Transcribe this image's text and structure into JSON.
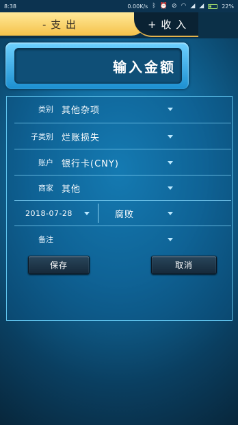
{
  "status_bar": {
    "time": "8:38",
    "net_speed": "0.00K/s",
    "battery": "22%",
    "icons": [
      "bluetooth-icon",
      "alarm-icon",
      "mute-icon",
      "wifi-icon",
      "signal-icon",
      "signal-icon",
      "battery-icon"
    ]
  },
  "tabs": {
    "expense": "- 支 出",
    "income": "+ 收 入"
  },
  "amount": {
    "placeholder": "输入金额"
  },
  "form": {
    "category": {
      "label": "类别",
      "value": "其他杂项"
    },
    "subcategory": {
      "label": "子类别",
      "value": "烂账损失"
    },
    "account": {
      "label": "账户",
      "value": "银行卡(CNY)"
    },
    "merchant": {
      "label": "商家",
      "value": "其他"
    },
    "date": {
      "value": "2018-07-28"
    },
    "mode": {
      "value": "腐败"
    },
    "note": {
      "label": "备注",
      "value": ""
    }
  },
  "buttons": {
    "save": "保存",
    "cancel": "取消"
  },
  "colors": {
    "accent_tab": "#f5c24a",
    "panel_border": "#5ec2ec",
    "amount_box": "#1c8fd0",
    "background": "#11689a"
  }
}
